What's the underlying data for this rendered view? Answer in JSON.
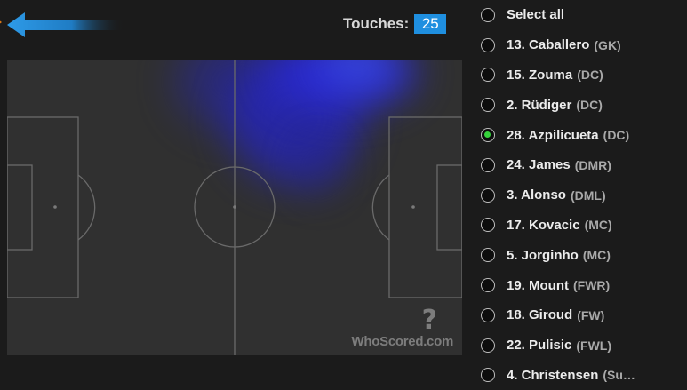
{
  "header": {
    "touches_label": "Touches:",
    "touches_value": "25"
  },
  "pitch": {
    "watermark": "WhoScored",
    "watermark_suffix": ".com",
    "logo_glyph": "?"
  },
  "players": {
    "select_all": "Select all",
    "items": [
      {
        "label": "13. Caballero",
        "pos": "(GK)",
        "selected": false
      },
      {
        "label": "15. Zouma",
        "pos": "(DC)",
        "selected": false
      },
      {
        "label": "2. Rüdiger",
        "pos": "(DC)",
        "selected": false
      },
      {
        "label": "28. Azpilicueta",
        "pos": "(DC)",
        "selected": true
      },
      {
        "label": "24. James",
        "pos": "(DMR)",
        "selected": false
      },
      {
        "label": "3. Alonso",
        "pos": "(DML)",
        "selected": false
      },
      {
        "label": "17. Kovacic",
        "pos": "(MC)",
        "selected": false
      },
      {
        "label": "5. Jorginho",
        "pos": "(MC)",
        "selected": false
      },
      {
        "label": "19. Mount",
        "pos": "(FWR)",
        "selected": false
      },
      {
        "label": "18. Giroud",
        "pos": "(FW)",
        "selected": false
      },
      {
        "label": "22. Pulisic",
        "pos": "(FWL)",
        "selected": false
      },
      {
        "label": "4. Christensen",
        "pos": "(Su…",
        "selected": false
      }
    ]
  },
  "colors": {
    "accent": "#1f8fe0",
    "selected": "#35d13b",
    "heat": "#2a2ad8"
  }
}
